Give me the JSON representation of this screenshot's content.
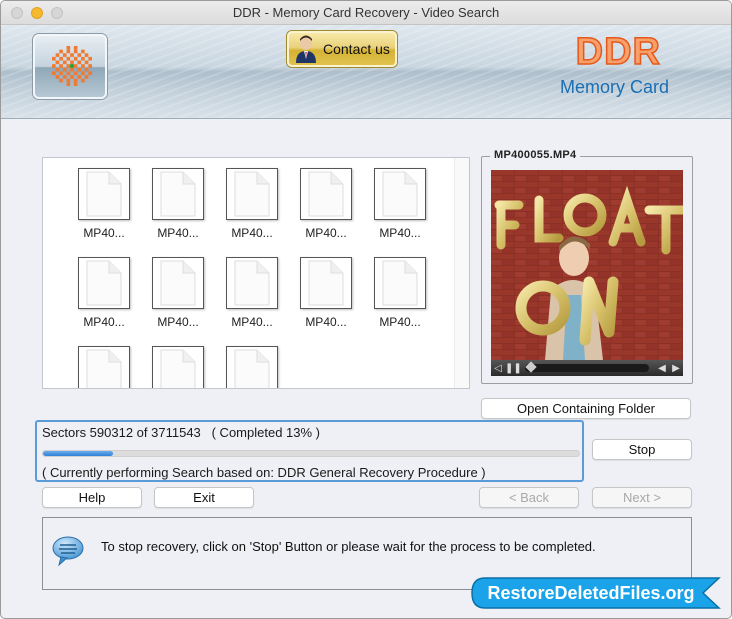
{
  "window": {
    "title": "DDR - Memory Card Recovery - Video Search"
  },
  "banner": {
    "contact_label": "Contact us",
    "brand_name": "DDR",
    "brand_product": "Memory Card",
    "brand_color": "#e4591b",
    "product_color": "#1b6fb3"
  },
  "files": {
    "items": [
      {
        "name": "MP40..."
      },
      {
        "name": "MP40..."
      },
      {
        "name": "MP40..."
      },
      {
        "name": "MP40..."
      },
      {
        "name": "MP40..."
      },
      {
        "name": "MP40..."
      },
      {
        "name": "MP40..."
      },
      {
        "name": "MP40..."
      },
      {
        "name": "MP40..."
      },
      {
        "name": "MP40..."
      },
      {
        "name": ""
      },
      {
        "name": ""
      },
      {
        "name": ""
      }
    ]
  },
  "preview": {
    "filename": "MP400055.MP4",
    "video_caption": "FLOAT ON",
    "playback_position": 0.02,
    "icons": [
      "volume-icon",
      "pause-icon",
      "step-back-icon",
      "step-forward-icon"
    ]
  },
  "buttons": {
    "open_folder": "Open Containing Folder",
    "stop": "Stop",
    "help": "Help",
    "exit": "Exit",
    "back": "< Back",
    "next": "Next >"
  },
  "progress": {
    "sectors_text": "Sectors 590312 of 3711543   ( Completed 13% )",
    "sectors_done": 590312,
    "sectors_total": 3711543,
    "percent": 13,
    "status_text": "( Currently performing Search based on: DDR General Recovery Procedure )",
    "accent": "#2f7fd6"
  },
  "info": {
    "message": "To stop recovery, click on 'Stop' Button or please wait for the process to be completed."
  },
  "watermark": {
    "text": "RestoreDeletedFiles.org",
    "color": "#1aa3e8"
  }
}
